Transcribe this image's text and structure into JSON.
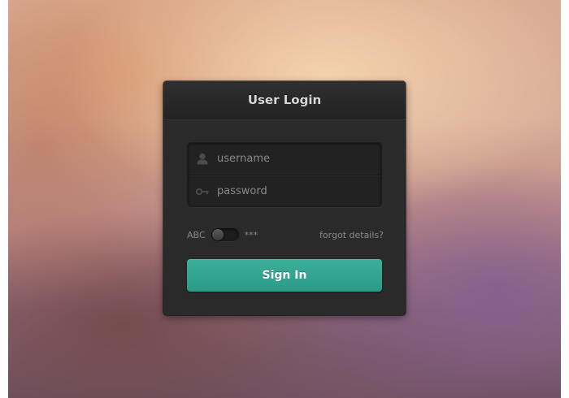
{
  "panel": {
    "title": "User Login"
  },
  "fields": {
    "username": {
      "placeholder": "username",
      "icon": "user-icon"
    },
    "password": {
      "placeholder": "password",
      "icon": "key-icon"
    }
  },
  "toggle": {
    "left_label": "ABC",
    "right_label": "***",
    "state": "off"
  },
  "forgot_link": "forgot details?",
  "signin_label": "Sign In",
  "colors": {
    "accent": "#32a590",
    "panel": "#2a2a2a",
    "text_muted": "#8a8a8a"
  }
}
